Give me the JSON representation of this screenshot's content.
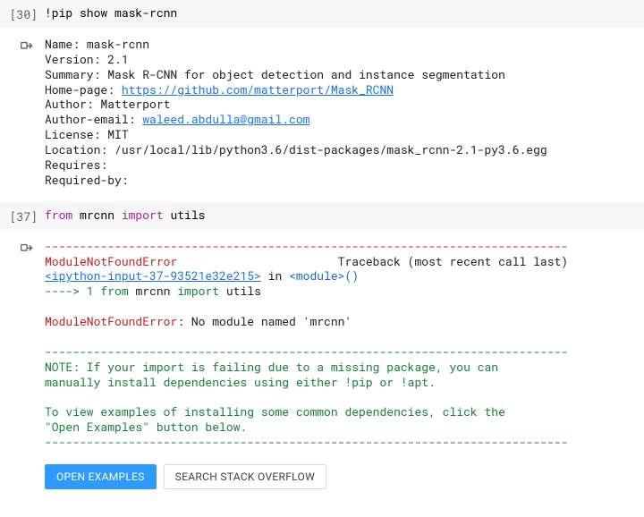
{
  "cell1": {
    "exec_label": "[30]",
    "code": "!pip show mask-rcnn",
    "out": {
      "name_label": "Name: ",
      "name": "mask-rcnn",
      "version_label": "Version: ",
      "version": "2.1",
      "summary_label": "Summary: ",
      "summary": "Mask R-CNN for object detection and instance segmentation",
      "home_label": "Home-page: ",
      "home_url": "https://github.com/matterport/Mask_RCNN",
      "author_label": "Author: ",
      "author": "Matterport",
      "author_email_label": "Author-email: ",
      "author_email": "waleed.abdulla@gmail.com",
      "license_label": "License: ",
      "license": "MIT",
      "location_label": "Location: ",
      "location": "/usr/local/lib/python3.6/dist-packages/mask_rcnn-2.1-py3.6.egg",
      "requires_label": "Requires: ",
      "requires": "",
      "required_by_label": "Required-by:",
      "required_by": ""
    }
  },
  "cell2": {
    "exec_label": "[37]",
    "code": {
      "from": "from",
      "pkg": " mrcnn ",
      "import": "import",
      "sym": " utils"
    },
    "tb": {
      "dashes": "---------------------------------------------------------------------------",
      "err_name": "ModuleNotFoundError",
      "err_tail": "                       Traceback (most recent call last)",
      "frame_file": "<ipython-input-37-93521e32e215>",
      "frame_in": " in ",
      "frame_mod": "<module>",
      "frame_parens": "()",
      "arrow": "----> 1 ",
      "arrow_from": "from",
      "arrow_pkg": " mrcnn ",
      "arrow_import": "import",
      "arrow_sym": " utils",
      "err_line": "ModuleNotFoundError",
      "err_msg": ": No module named 'mrcnn'",
      "dashes2": "---------------------------------------------------------------------------",
      "note1": "NOTE: If your import is failing due to a missing package, you can",
      "note2": "manually install dependencies using either !pip or !apt.",
      "note3": "To view examples of installing some common dependencies, click the",
      "note4": "\"Open Examples\" button below.",
      "dashes3": "---------------------------------------------------------------------------"
    },
    "buttons": {
      "open_examples": "OPEN EXAMPLES",
      "search_so": "SEARCH STACK OVERFLOW"
    }
  }
}
